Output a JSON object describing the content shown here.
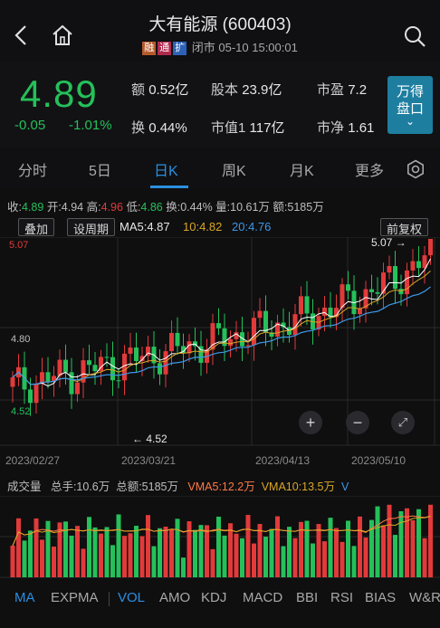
{
  "header": {
    "title": "大有能源 (600403)",
    "tags": [
      "融",
      "通",
      "扩"
    ],
    "status": "闭市 05-10 15:00:01"
  },
  "quote": {
    "price": "4.89",
    "change": "-0.05",
    "change_pct": "-1.01%",
    "metrics": [
      {
        "k": "额",
        "v": "0.52亿"
      },
      {
        "k": "股本",
        "v": "23.9亿"
      },
      {
        "k": "市盈",
        "v": "7.2"
      },
      {
        "k": "换",
        "v": "0.44%"
      },
      {
        "k": "市值1",
        "v": "117亿"
      },
      {
        "k": "市净",
        "v": "1.61"
      }
    ],
    "wande_line1": "万得",
    "wande_line2": "盘口",
    "wande_chevron": "⌄"
  },
  "tabs": [
    "分时",
    "5日",
    "日K",
    "周K",
    "月K",
    "更多"
  ],
  "active_tab": "日K",
  "info_bar": {
    "close_label": "收:",
    "close": "4.89",
    "open_label": "开:",
    "open": "4.94",
    "high_label": "高:",
    "high": "4.96",
    "low_label": "低:",
    "low": "4.86",
    "turnover_label": "换:",
    "turnover": "0.44%",
    "volume_label": "量:",
    "volume": "10.61万",
    "amount_label": "额:",
    "amount": "5185万"
  },
  "toolbar": {
    "overlay": "叠加",
    "period": "设周期",
    "ma5": "MA5:4.87",
    "ma10": "10:4.82",
    "ma20": "20:4.76",
    "adjust": "前复权"
  },
  "kline": {
    "max_price_label": "5.07",
    "max_marker": "5.07 →",
    "mid_price_label": "4.80",
    "min_price_label": "4.52",
    "min_marker": "← 4.52",
    "dates": [
      "2023/02/27",
      "2023/03/21",
      "2023/04/13",
      "2023/05/10"
    ]
  },
  "volume_bar": {
    "label": "成交量",
    "total_hands": "总手:10.6万",
    "total_amount": "总额:5185万",
    "vma5": "VMA5:12.2万",
    "vma10": "VMA10:13.5万",
    "v": "V"
  },
  "indicators": [
    "MA",
    "EXPMA",
    "VOL",
    "AMO",
    "KDJ",
    "MACD",
    "BBI",
    "RSI",
    "BIAS",
    "W&R"
  ],
  "active_indicators": [
    "MA",
    "VOL"
  ],
  "colors": {
    "up": "#e23a3a",
    "down": "#25c05a",
    "ma5": "#ffffff",
    "ma10": "#d9a625",
    "ma20": "#3d97e6",
    "accent": "#2b8fe0"
  }
}
